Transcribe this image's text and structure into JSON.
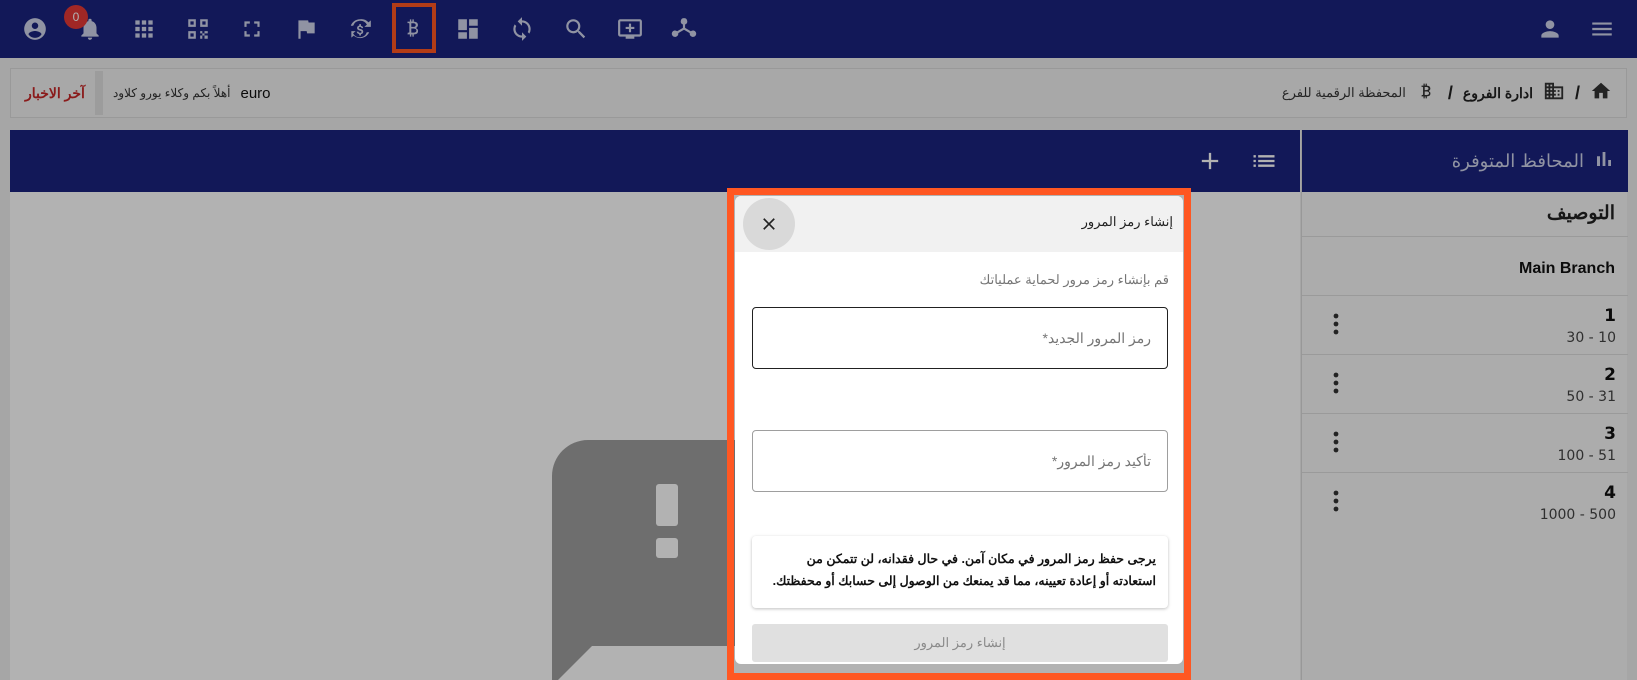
{
  "topbar": {
    "notification_count": "0",
    "icons": [
      "account-circle-icon",
      "bell-icon",
      "apps-grid-icon",
      "qr-scan-icon",
      "fullscreen-icon",
      "flag-icon",
      "currency-exchange-icon",
      "bitcoin-icon",
      "dashboard-icon",
      "sync-icon",
      "search-icon",
      "add-to-queue-icon",
      "hierarchy-icon",
      "person-icon",
      "menu-icon"
    ],
    "active_icon": "bitcoin-icon"
  },
  "breadcrumb": {
    "main": "ادارة الفروع",
    "separator": "/",
    "current": "المحفظة الرقمية للفرع"
  },
  "news": {
    "label": "آخر الاخبار",
    "ticker_text": "أهلاً بكم وكلاء يورو كلاود",
    "ticker_word": "euro"
  },
  "sidebar": {
    "title": "المحافظ المتوفرة",
    "column_title": "التوصيف",
    "branch": "Main Branch",
    "rows": [
      {
        "num": "1",
        "range": "30 - 10"
      },
      {
        "num": "2",
        "range": "50 - 31"
      },
      {
        "num": "3",
        "range": "100 - 51"
      },
      {
        "num": "4",
        "range": "1000 - 500"
      }
    ]
  },
  "modal": {
    "title": "إنشاء رمز المرور",
    "description": "قم بإنشاء رمز مرور لحماية عملياتك",
    "new_password_placeholder": "رمز المرور الجديد*",
    "confirm_password_placeholder": "تأكيد رمز المرور*",
    "notice": "يرجى حفظ رمز المرور في مكان آمن. في حال فقدانه، لن تتمكن من استعادته أو إعادة تعيينه، مما قد يمنعك من الوصول إلى حسابك أو محفظتك.",
    "submit_label": "إنشاء رمز المرور"
  },
  "colors": {
    "primary": "#1a237e",
    "highlight": "#ff5722",
    "badge": "#e53935",
    "news_label": "#c62828"
  }
}
